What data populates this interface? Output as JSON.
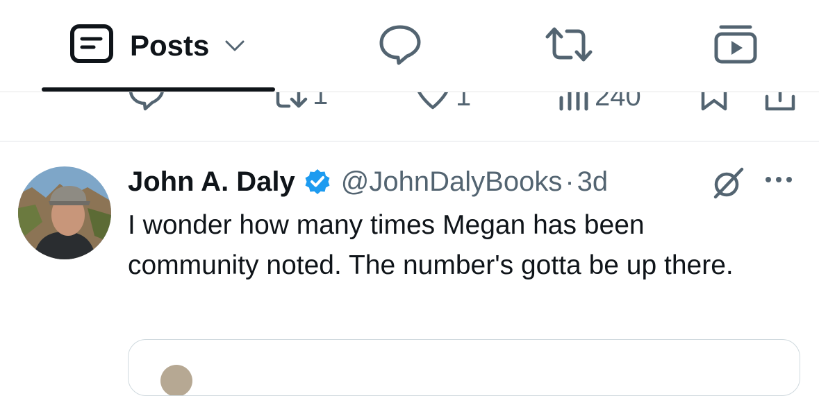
{
  "tabs": {
    "posts_label": "Posts",
    "icons": [
      "posts-icon",
      "chevron-down-icon",
      "reply-icon",
      "repost-icon",
      "media-icon"
    ]
  },
  "previous_post_actions": {
    "reposts": "1",
    "likes": "1",
    "views": "240"
  },
  "post": {
    "author_name": "John A. Daly",
    "handle": "@JohnDalyBooks",
    "separator": "·",
    "time": "3d",
    "text": "I wonder how many times Megan has been community noted. The number's gotta be up there."
  },
  "colors": {
    "text": "#0f1419",
    "secondary": "#536471",
    "verified": "#1d9bf0",
    "divider": "#e1e4e7"
  }
}
